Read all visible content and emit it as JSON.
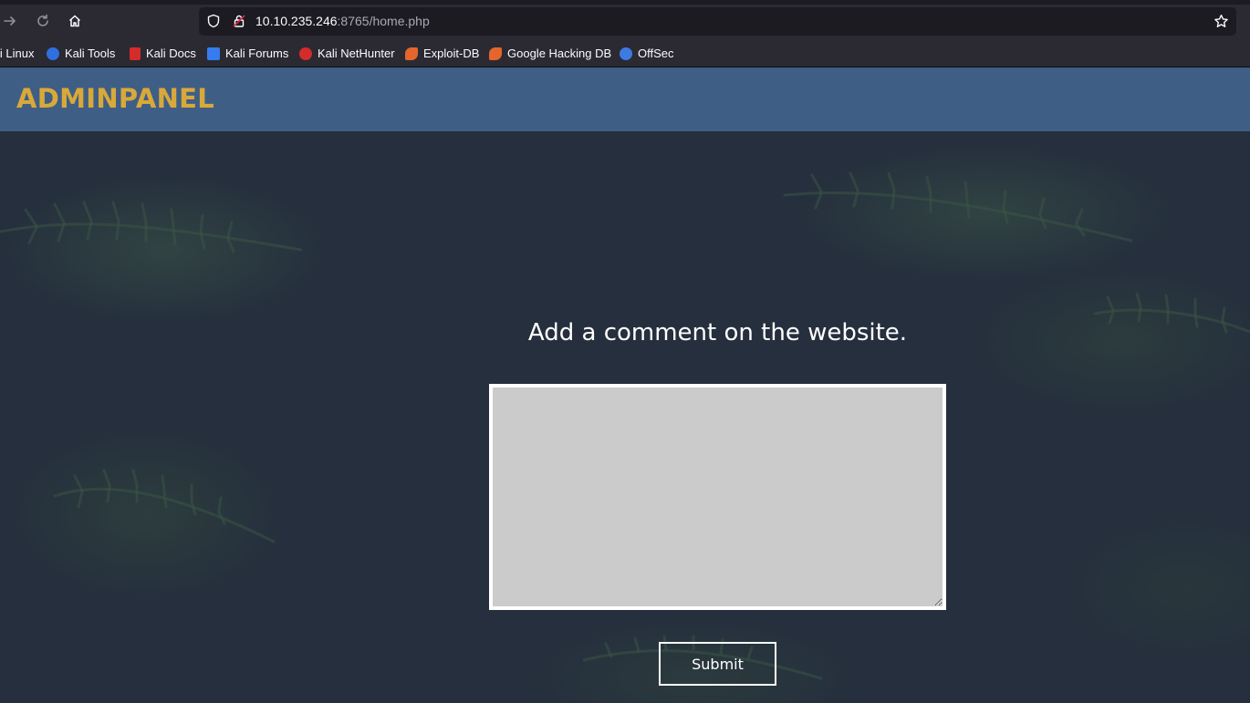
{
  "browser": {
    "url_host": "10.10.235.246",
    "url_rest": ":8765/home.php",
    "bookmarks": [
      {
        "label": "li Linux",
        "color": "#367bf0"
      },
      {
        "label": "Kali Tools",
        "color": "#2f6fe0"
      },
      {
        "label": "Kali Docs",
        "color": "#d52b2b"
      },
      {
        "label": "Kali Forums",
        "color": "#367bf0"
      },
      {
        "label": "Kali NetHunter",
        "color": "#d52b2b"
      },
      {
        "label": "Exploit-DB",
        "color": "#e4662d"
      },
      {
        "label": "Google Hacking DB",
        "color": "#e4662d"
      },
      {
        "label": "OffSec",
        "color": "#3d7be0"
      }
    ]
  },
  "site": {
    "logo": "ADMINPANEL",
    "heading": "Add a comment on the website.",
    "comment_placeholder": "",
    "submit_label": "Submit"
  },
  "colors": {
    "header_bg": "#3f5e86",
    "logo": "#d8a93a",
    "hero_bg": "#252f3d",
    "textarea_bg": "#cbcbcb"
  }
}
